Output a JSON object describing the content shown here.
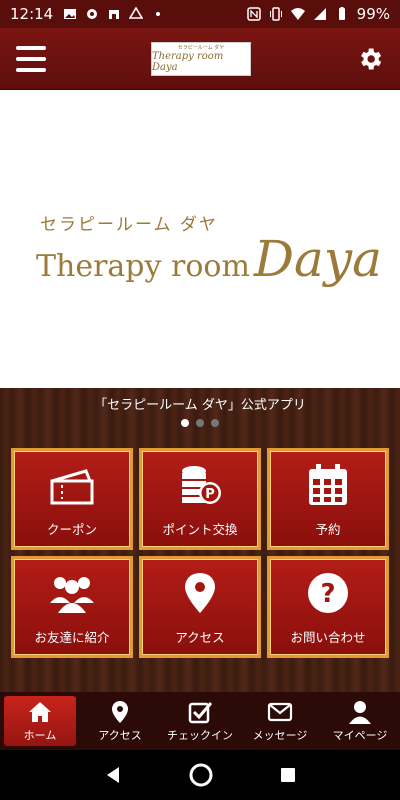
{
  "status_bar": {
    "time": "12:14",
    "battery": "99%"
  },
  "header": {
    "logo_line1": "セラピールーム ダヤ",
    "logo_line2": "Therapy room Daya"
  },
  "hero": {
    "subtitle": "セラピールーム ダヤ",
    "title_part1": "Therapy room",
    "title_part2": "Daya"
  },
  "banner": {
    "text": "「セラピールーム ダヤ」公式アプリ",
    "page_count": 3,
    "active_page": 1
  },
  "tiles": [
    {
      "label": "クーポン",
      "icon": "ticket-icon"
    },
    {
      "label": "ポイント交換",
      "icon": "coins-icon"
    },
    {
      "label": "予約",
      "icon": "calendar-icon"
    },
    {
      "label": "お友達に紹介",
      "icon": "people-icon"
    },
    {
      "label": "アクセス",
      "icon": "map-pin-icon"
    },
    {
      "label": "お問い合わせ",
      "icon": "question-icon"
    }
  ],
  "nav": [
    {
      "label": "ホーム",
      "icon": "home-icon",
      "active": true
    },
    {
      "label": "アクセス",
      "icon": "map-pin-icon"
    },
    {
      "label": "チェックイン",
      "icon": "checkbox-icon"
    },
    {
      "label": "メッセージ",
      "icon": "mail-icon"
    },
    {
      "label": "マイページ",
      "icon": "user-icon"
    }
  ],
  "colors": {
    "header": "#6a1210",
    "tile": "#a3160f",
    "tile_border": "#e29a35",
    "gold_text": "#9b7a3a"
  }
}
